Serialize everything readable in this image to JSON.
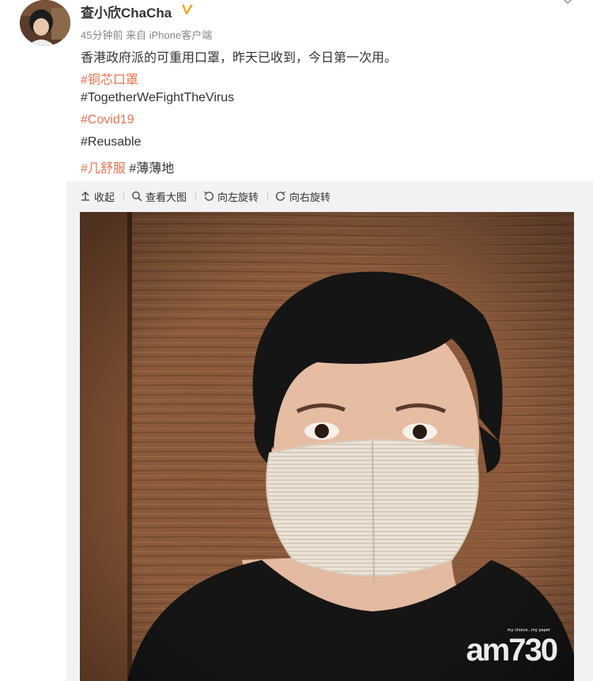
{
  "author": {
    "name": "查小欣ChaCha",
    "verified_icon": "verified-badge-icon"
  },
  "meta": {
    "time": "45分钟前",
    "from_label": "来自",
    "source": "iPhone客户端"
  },
  "post": {
    "text": "香港政府派的可重用口罩，昨天已收到，今日第一次用。",
    "hashtags": {
      "h1": "#铜芯口罩",
      "h2": "#TogetherWeFightTheVirus",
      "h3": "#Covid19",
      "h4": "#Reusable",
      "h5": "#几舒服",
      "h6": "#薄薄地"
    }
  },
  "toolbar": {
    "collapse": "收起",
    "view_large": "查看大图",
    "rotate_left": "向左旋转",
    "rotate_right": "向右旋转"
  },
  "watermark": {
    "text": "am730",
    "tagline": "my choice...my paper"
  },
  "colors": {
    "hashtag": "#eb7350",
    "meta": "#888888",
    "media_background": "#f2f2f5",
    "verified": "#f5a623"
  }
}
